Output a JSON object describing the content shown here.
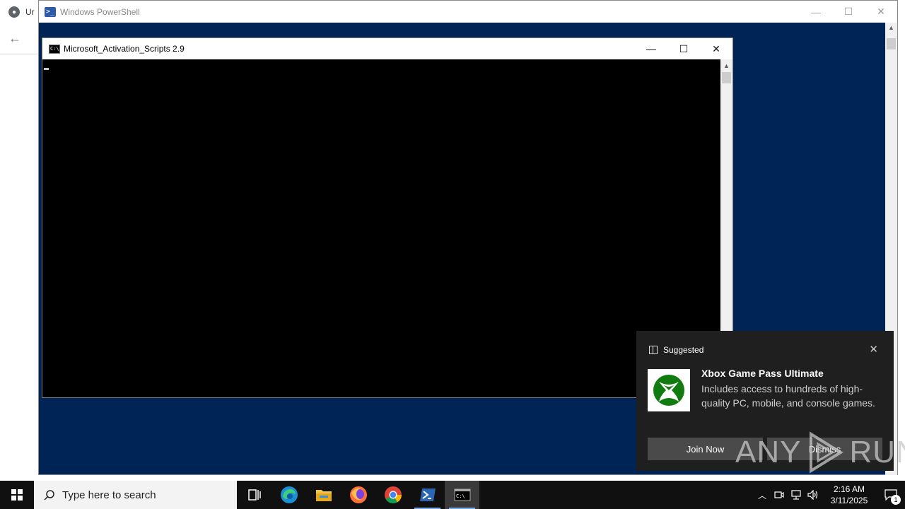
{
  "browser": {
    "tab_label": "Ur"
  },
  "powershell": {
    "title": "Windows PowerShell",
    "icon": "powershell-icon"
  },
  "cmd": {
    "title": "Microsoft_Activation_Scripts 2.9",
    "icon": "cmd-icon"
  },
  "toast": {
    "header": "Suggested",
    "title": "Xbox Game Pass Ultimate",
    "text": "Includes access to hundreds of high-quality PC, mobile, and console games.",
    "join_label": "Join Now",
    "dismiss_label": "Dismiss",
    "logo": "xbox-logo",
    "accent": "#107c10"
  },
  "watermark": {
    "left": "ANY",
    "right": "RUN"
  },
  "taskbar": {
    "search_placeholder": "Type here to search",
    "apps": [
      "task-view-icon",
      "edge-icon",
      "file-explorer-icon",
      "firefox-icon",
      "chrome-icon",
      "powershell-icon",
      "cmd-icon"
    ],
    "time": "2:16 AM",
    "date": "3/11/2025",
    "notification_count": "1"
  },
  "colors": {
    "powershell_bg": "#012456",
    "taskbar_bg": "#101010",
    "toast_bg": "#1f1f1f"
  }
}
